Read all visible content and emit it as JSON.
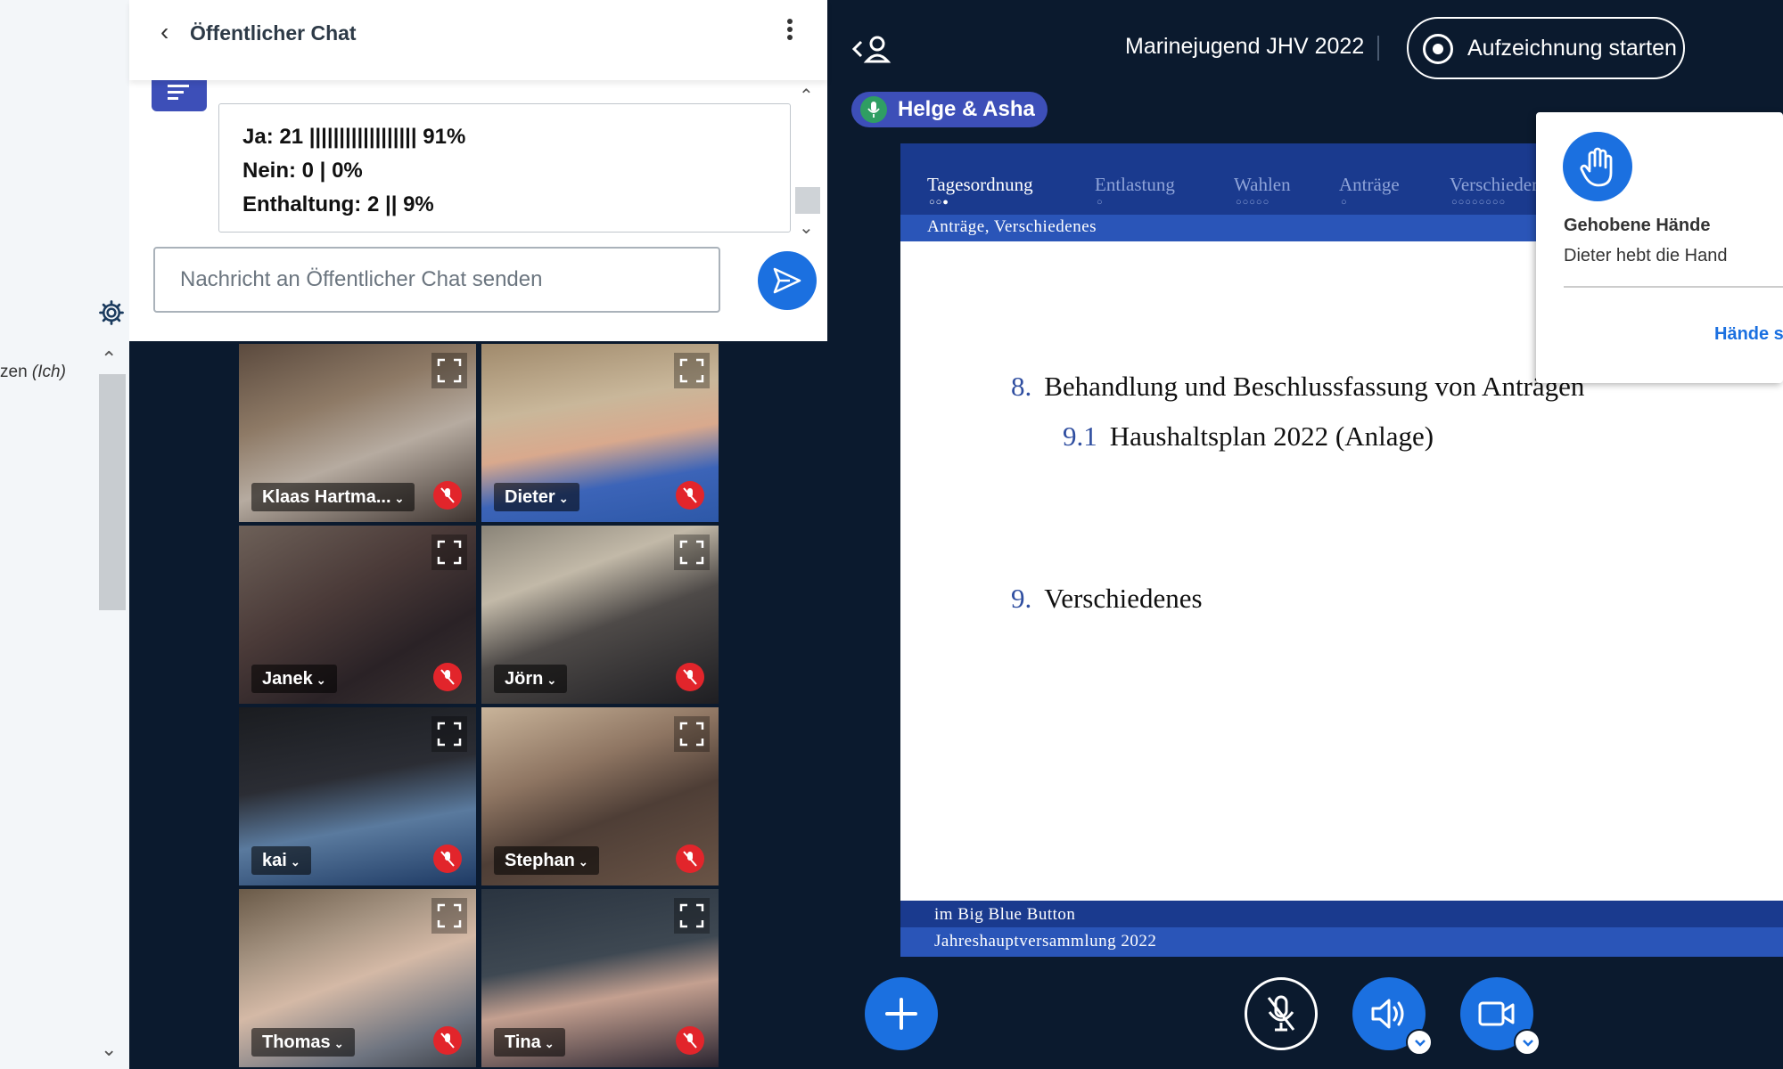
{
  "user_list": {
    "current_user_name": "zen",
    "current_user_suffix": "(Ich)"
  },
  "chat": {
    "title": "Öffentlicher Chat",
    "poll_results": [
      "Ja: 21 |||||||||||||||||| 91%",
      "Nein: 0 | 0%",
      "Enthaltung: 2 || 9%"
    ],
    "input_placeholder": "Nachricht an Öffentlicher Chat senden"
  },
  "webcams": [
    {
      "name": "Klaas Hartma...",
      "muted": true
    },
    {
      "name": "Dieter",
      "muted": true
    },
    {
      "name": "Janek",
      "muted": true
    },
    {
      "name": "Jörn",
      "muted": true
    },
    {
      "name": "kai",
      "muted": true
    },
    {
      "name": "Stephan",
      "muted": true
    },
    {
      "name": "Thomas",
      "muted": true
    },
    {
      "name": "Tina",
      "muted": true
    }
  ],
  "header": {
    "meeting_title": "Marinejugend JHV 2022",
    "record_label": "Aufzeichnung starten"
  },
  "talking_indicator": {
    "label": "Helge & Asha"
  },
  "slide": {
    "nav": [
      {
        "label": "Tagesordnung",
        "dots": "○○●",
        "active": true
      },
      {
        "label": "Entlastung",
        "dots": "○",
        "active": false
      },
      {
        "label": "Wahlen",
        "dots": "○○○○○",
        "active": false
      },
      {
        "label": "Anträge",
        "dots": "○",
        "active": false
      },
      {
        "label": "Verschiedenes",
        "dots": "○○○○○○○○",
        "active": false
      }
    ],
    "section": "Anträge, Verschiedenes",
    "items": [
      {
        "num": "8.",
        "text": "Behandlung und Beschlussfassung von Anträgen"
      },
      {
        "num": "9.1",
        "text": "Haushaltsplan 2022 (Anlage)"
      },
      {
        "num": "9.",
        "text": "Verschiedenes"
      }
    ],
    "footer_line1": "im Big Blue Button",
    "footer_line2": "Jahreshauptversammlung 2022"
  },
  "raised_hands": {
    "title": "Gehobene Hände",
    "message": "Dieter hebt die Hand",
    "lower_button": "Hände s"
  },
  "colors": {
    "accent": "#1b70e0",
    "background": "#0b1a2e",
    "slide_nav": "#1a3a8e",
    "slide_sub": "#2a55b8",
    "talking": "#3d4fb8",
    "mute_red": "#e2252b"
  }
}
